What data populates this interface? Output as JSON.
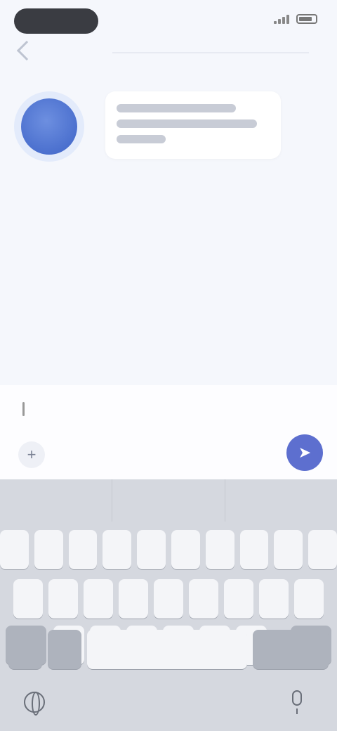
{
  "status_bar": {
    "time": ""
  },
  "header": {
    "title": ""
  },
  "chat": {
    "bot_message": ""
  },
  "composer": {
    "input_value": "",
    "input_placeholder": "",
    "attach_icon": "plus-icon",
    "send_icon": "send-icon"
  },
  "keyboard": {
    "suggestions": [
      "",
      "",
      ""
    ],
    "row1": [
      "",
      "",
      "",
      "",
      "",
      "",
      "",
      "",
      "",
      ""
    ],
    "row2": [
      "",
      "",
      "",
      "",
      "",
      "",
      "",
      "",
      ""
    ],
    "row3": [
      "",
      "",
      "",
      "",
      "",
      "",
      ""
    ],
    "space_label": "",
    "return_label": ""
  },
  "colors": {
    "accent": "#5d6fcf",
    "avatar": "#4a6fd0",
    "background": "#f5f7fc",
    "keyboard": "#d5d8df"
  }
}
